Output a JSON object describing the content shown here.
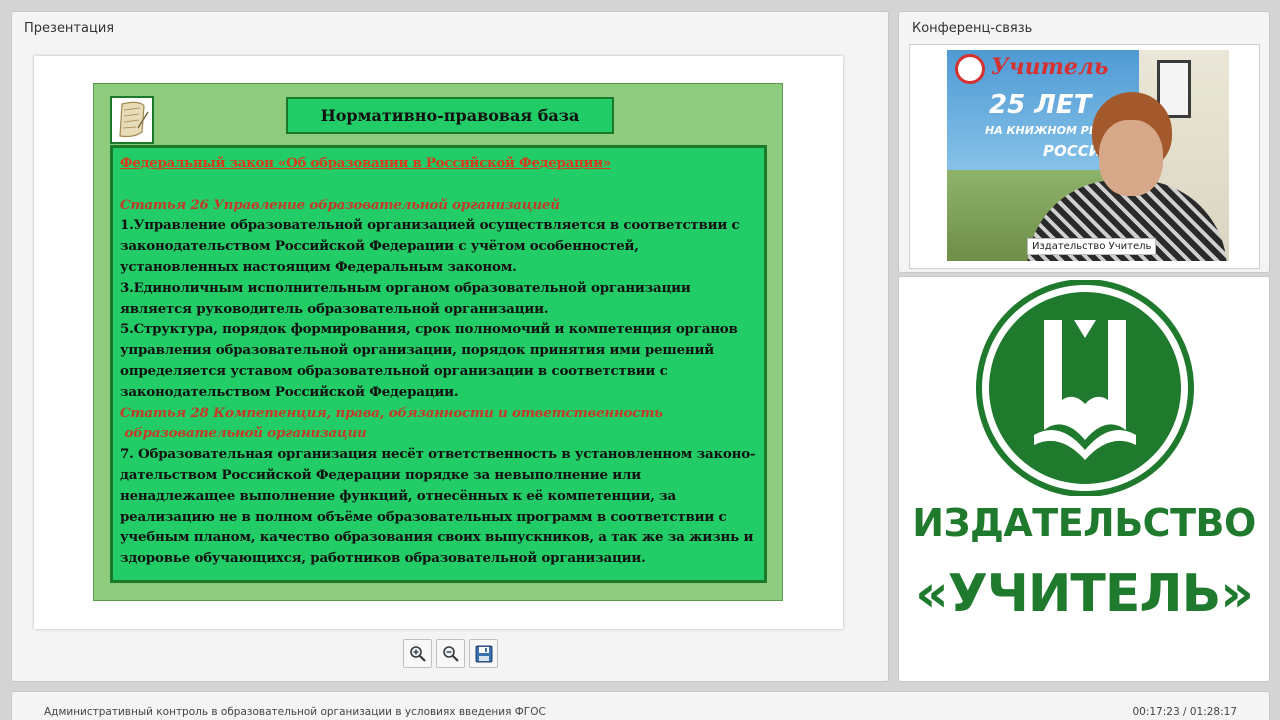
{
  "presentation": {
    "panel_title": "Презентация",
    "slide": {
      "title": "Нормативно-правовая база",
      "law_heading": "Федеральный закон «Об образовании в Российской Федерации»",
      "article26_heading": "Статья 26 Управление образовательной организацией",
      "item1": "1.Управление образовательной организацией осуществляется в соответствии с законодательством Российской Федерации с учётом особенностей, установленных настоящим Федеральным законом.",
      "item3": "3.Единоличным исполнительным органом образовательной организации является руководитель образовательной организации.",
      "item5": "5.Структура, порядок формирования, срок полномочий и компетенция органов управления образовательной организации, порядок принятия ими решений определяется  уставом образовательной организации в соответствии с законодательством Российской Федерации.",
      "article28_heading_line1": "Статья 28 Компетенция, права, обязанности и ответственность",
      "article28_heading_line2": " образовательной организации",
      "item7": "7. Образовательная организация  несёт ответственность в установленном  законо-дательством  Российской Федерации порядке за невыполнение или ненадлежащее выполнение функций,  отнесённых к её компетенции, за реализацию не в полном объёме образовательных программ в соответствии с учебным планом, качество образования своих выпускников, а  так же за жизнь и здоровье обучающихся, работников образовательной организации."
    },
    "tools": {
      "zoom_in_icon": "zoom-in-icon",
      "zoom_out_icon": "zoom-out-icon",
      "save_icon": "floppy-disk-icon"
    }
  },
  "conference": {
    "panel_title": "Конференц-связь",
    "video": {
      "caption": "Издательство Учитель",
      "banner_word": "Учитель",
      "banner_years": "25 ЛЕТ",
      "banner_sub": "НА КНИЖНОМ РЫНК",
      "banner_sub2": "РОССИ"
    }
  },
  "publisher": {
    "line1": "ИЗДАТЕЛЬСТВО",
    "line2": "«УЧИТЕЛЬ»",
    "color": "#1f7a2e"
  },
  "footer": {
    "course_title": "Административный контроль в образовательной организации в условиях введения ФГОС",
    "timer": "00:17:23 / 01:28:17"
  }
}
